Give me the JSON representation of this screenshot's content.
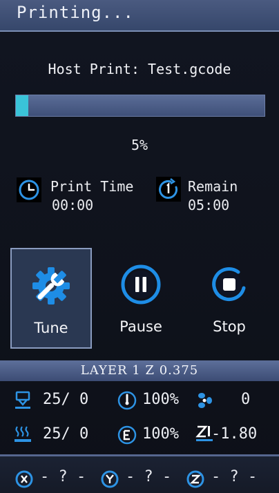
{
  "header": {
    "title": "Printing..."
  },
  "job": {
    "file_label": "Host Print: Test.gcode",
    "progress_fraction": 0.05,
    "progress_text": "5%"
  },
  "times": {
    "print_time_label": "Print Time",
    "print_time_value": "00:00",
    "remain_label": "Remain",
    "remain_value": "05:00"
  },
  "actions": [
    {
      "label": "Tune",
      "icon": "gear-wrench-icon",
      "selected": true
    },
    {
      "label": "Pause",
      "icon": "pause-icon",
      "selected": false
    },
    {
      "label": "Stop",
      "icon": "stop-icon",
      "selected": false
    }
  ],
  "layer_info": "LAYER 1 Z 0.375",
  "stats": {
    "hotend": "25/ 0",
    "bed": "25/ 0",
    "speed": "100%",
    "flow": "100%",
    "fan": "0",
    "z_offset": "-1.80"
  },
  "axes": {
    "x": "- ? -",
    "y": "- ? -",
    "z": "- ? -"
  },
  "colors": {
    "accent": "#3ac3d8",
    "icon_blue": "#1e8de6",
    "bar_blue": "#4a5a80",
    "background": "#0c0f16"
  }
}
